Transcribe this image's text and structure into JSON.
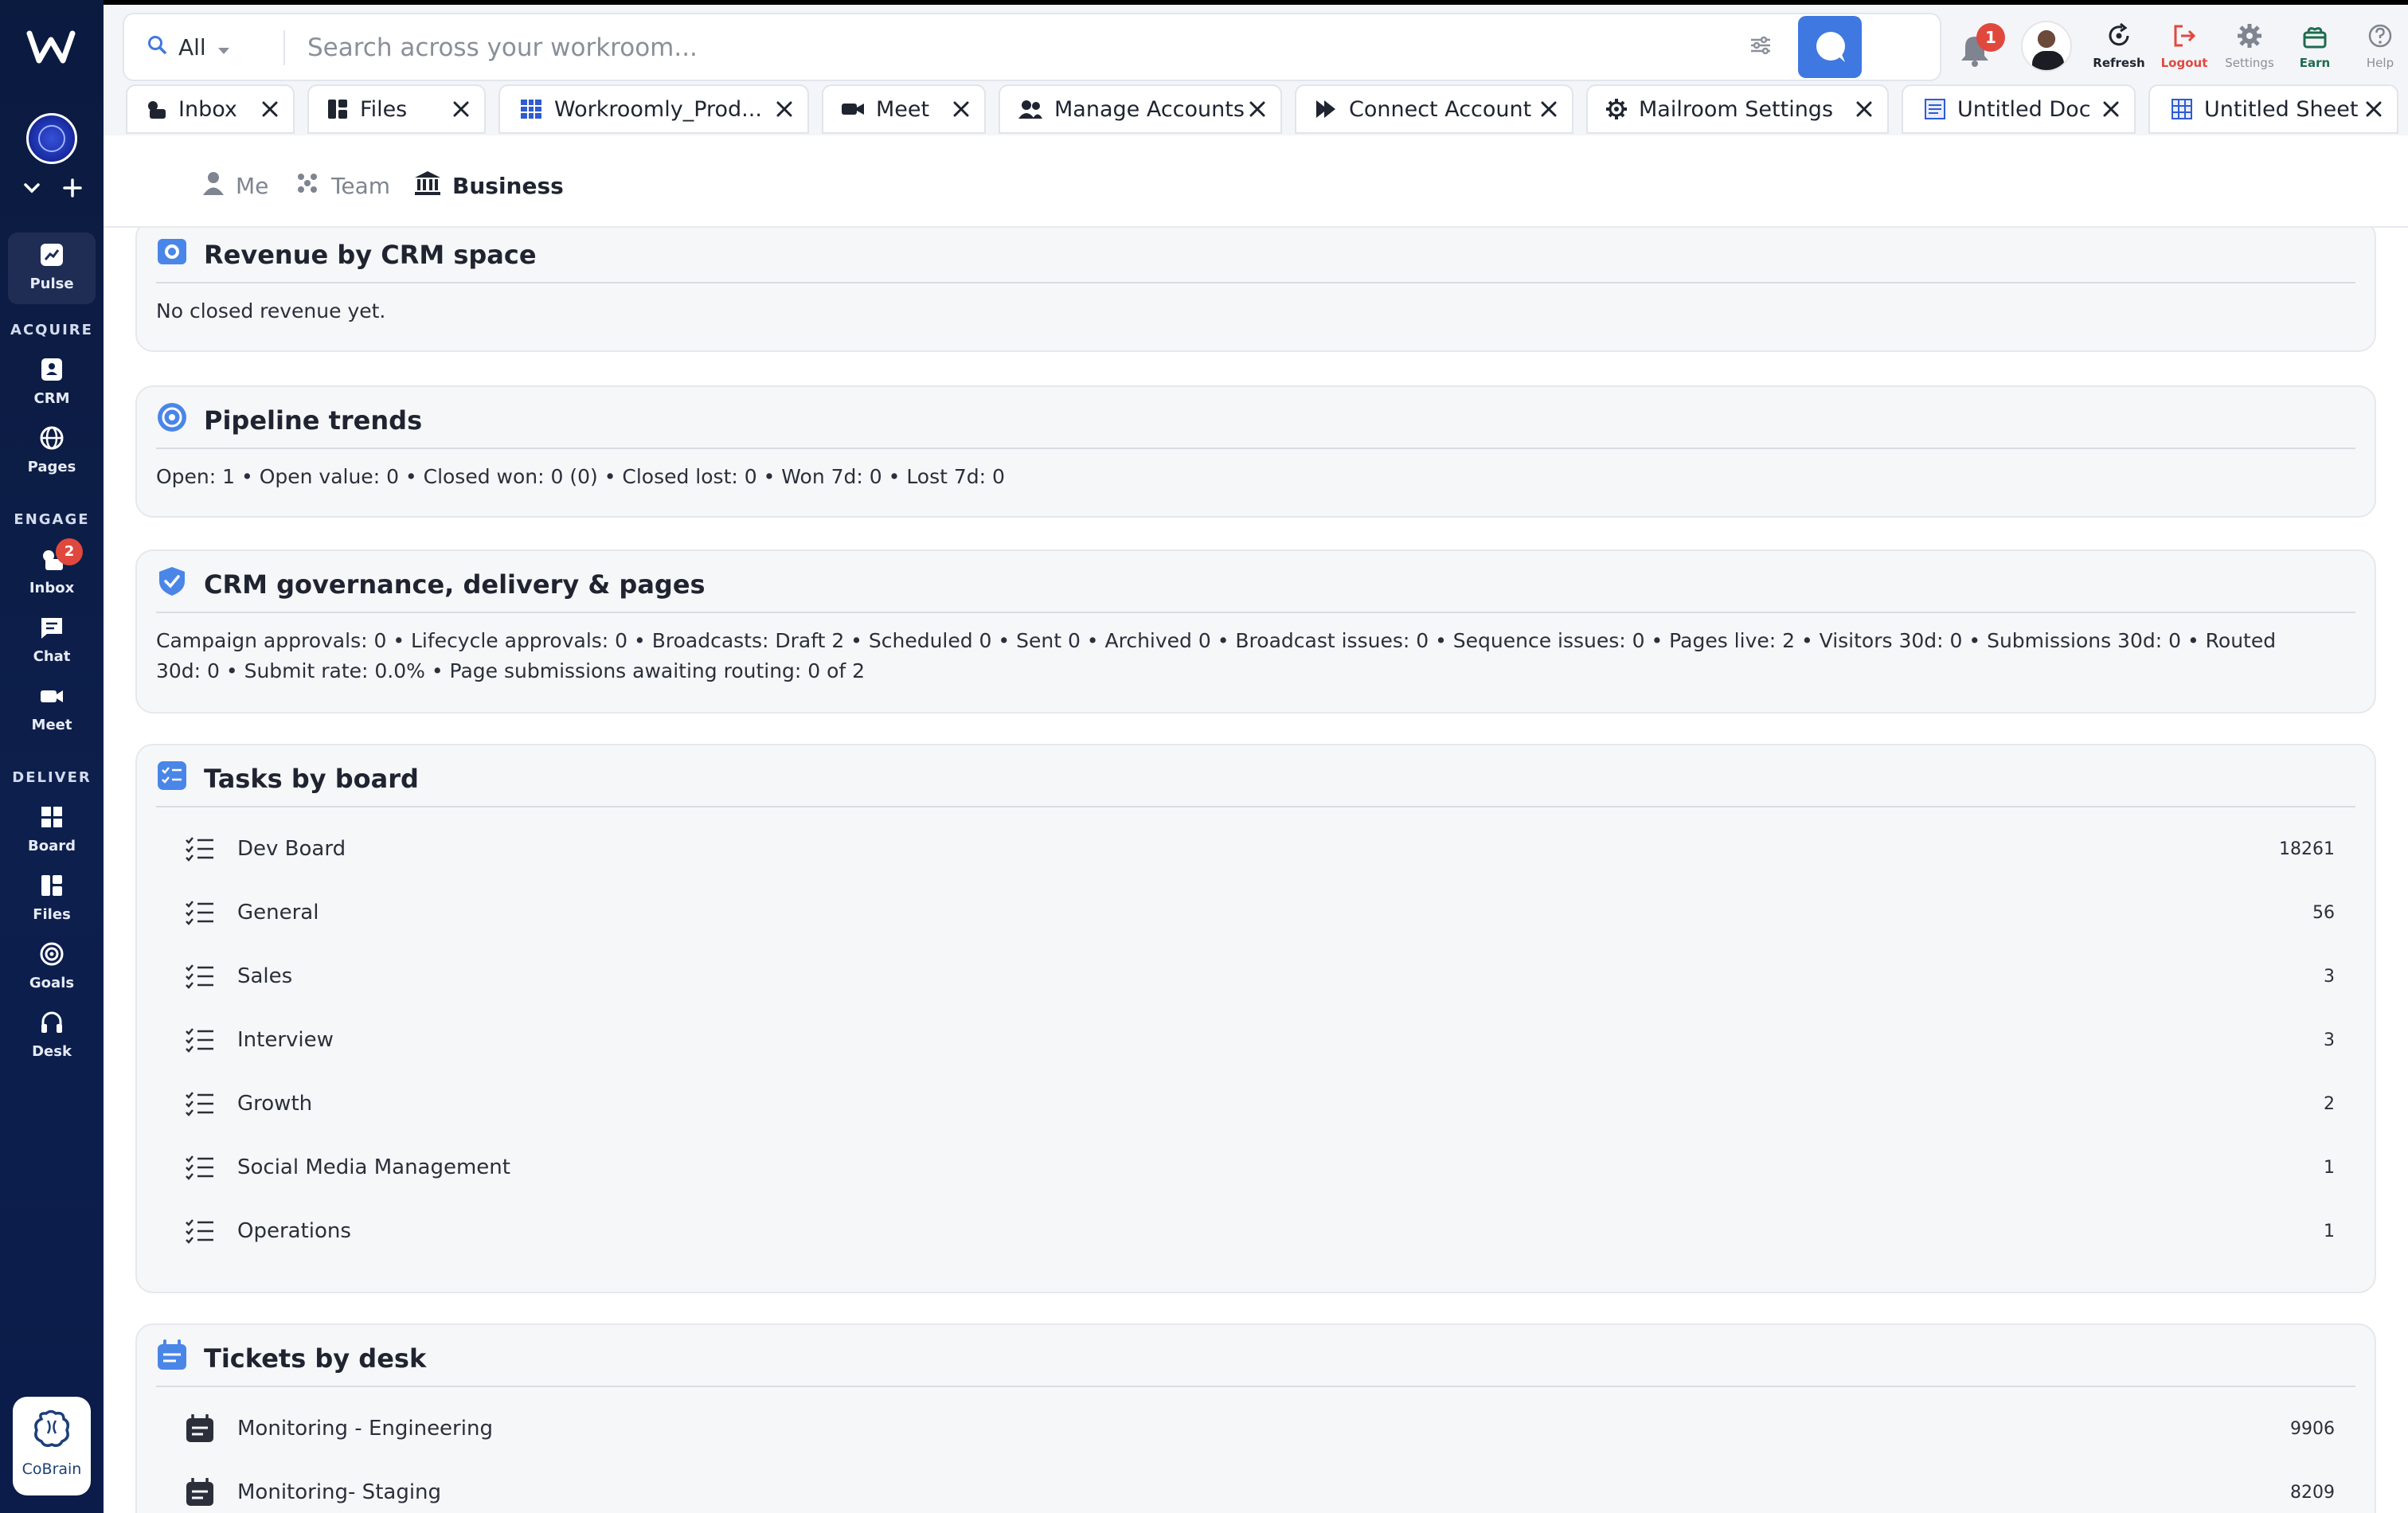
{
  "sidebar": {
    "sections": {
      "acquire": "ACQUIRE",
      "engage": "ENGAGE",
      "deliver": "DELIVER"
    },
    "items": {
      "pulse": "Pulse",
      "crm": "CRM",
      "pages": "Pages",
      "inbox": "Inbox",
      "inbox_badge": "2",
      "chat": "Chat",
      "meet": "Meet",
      "board": "Board",
      "files": "Files",
      "goals": "Goals",
      "desk": "Desk"
    },
    "cobrain": "CoBrain"
  },
  "search": {
    "scope": "All",
    "placeholder": "Search across your workroom...",
    "value": ""
  },
  "topbar": {
    "notifications_badge": "1",
    "refresh": "Refresh",
    "logout": "Logout",
    "settings": "Settings",
    "earn": "Earn",
    "help": "Help"
  },
  "tabs": [
    {
      "label": "Inbox"
    },
    {
      "label": "Files"
    },
    {
      "label": "Workroomly_Prod..."
    },
    {
      "label": "Meet"
    },
    {
      "label": "Manage Accounts"
    },
    {
      "label": "Connect Account"
    },
    {
      "label": "Mailroom Settings"
    },
    {
      "label": "Untitled Doc"
    },
    {
      "label": "Untitled Sheet"
    }
  ],
  "view": {
    "me": "Me",
    "team": "Team",
    "business": "Business"
  },
  "cards": {
    "revenue": {
      "title": "Revenue by CRM space",
      "body": "No closed revenue yet."
    },
    "pipeline": {
      "title": "Pipeline trends",
      "body": "Open: 1 • Open value: 0 • Closed won: 0 (0) • Closed lost: 0 • Won 7d: 0 • Lost 7d: 0"
    },
    "governance": {
      "title": "CRM governance, delivery & pages",
      "body": "Campaign approvals: 0 • Lifecycle approvals: 0 • Broadcasts: Draft 2 • Scheduled 0 • Sent 0 • Archived 0 • Broadcast issues: 0 • Sequence issues: 0 • Pages live: 2 • Visitors 30d: 0 • Submissions 30d: 0 • Routed 30d: 0 • Submit rate: 0.0% • Page submissions awaiting routing: 0 of 2"
    },
    "tasks": {
      "title": "Tasks by board",
      "rows": [
        {
          "name": "Dev Board",
          "count": "18261"
        },
        {
          "name": "General",
          "count": "56"
        },
        {
          "name": "Sales",
          "count": "3"
        },
        {
          "name": "Interview",
          "count": "3"
        },
        {
          "name": "Growth",
          "count": "2"
        },
        {
          "name": "Social Media Management",
          "count": "1"
        },
        {
          "name": "Operations",
          "count": "1"
        }
      ]
    },
    "tickets": {
      "title": "Tickets by desk",
      "rows": [
        {
          "name": "Monitoring - Engineering",
          "count": "9906"
        },
        {
          "name": "Monitoring- Staging",
          "count": "8209"
        }
      ]
    }
  },
  "colors": {
    "sidebar_bg": "#0d1f4c",
    "accent_blue": "#3f78e0",
    "badge_red": "#e0483e",
    "logout_red": "#e0483e",
    "earn_green": "#1e6b4d"
  }
}
